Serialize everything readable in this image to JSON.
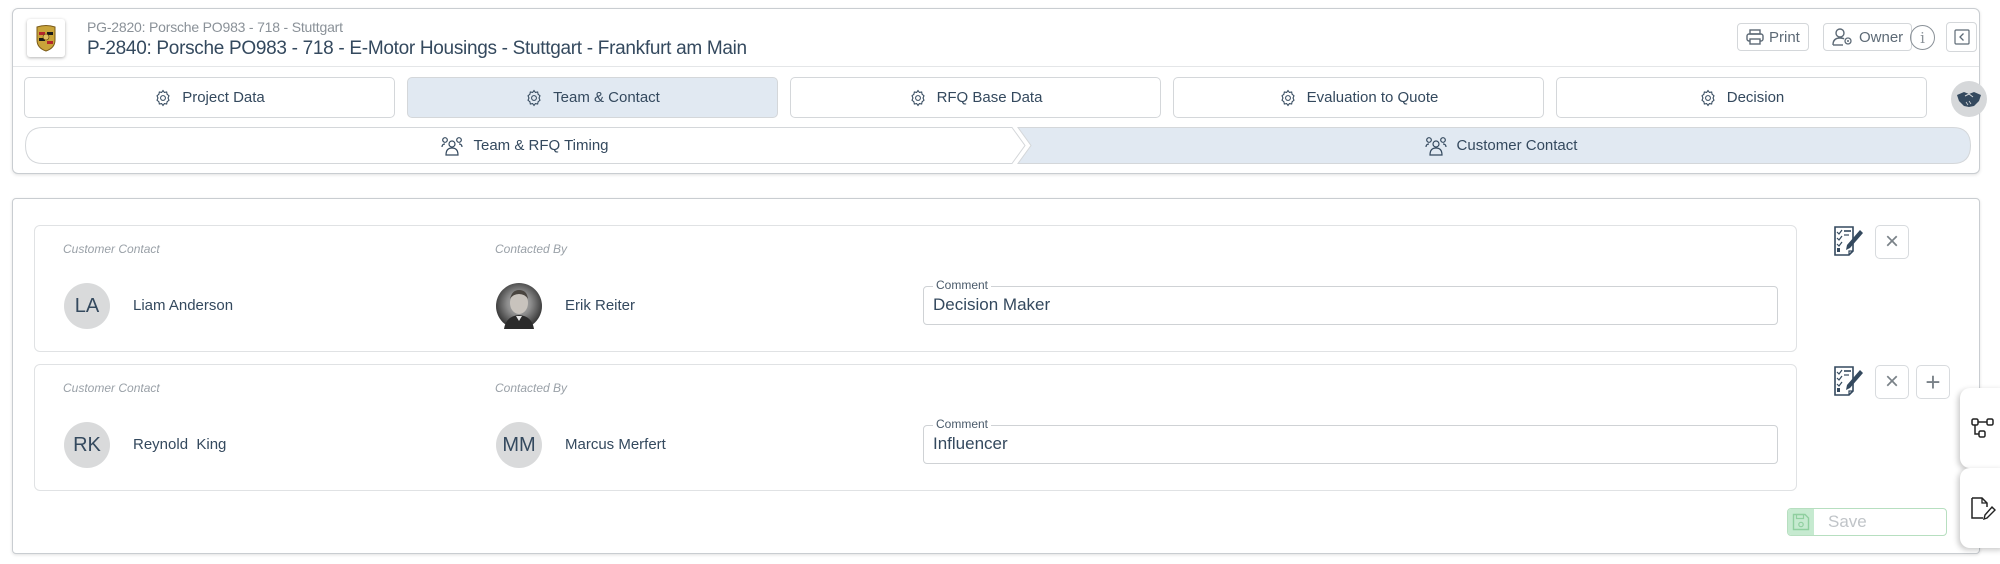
{
  "header": {
    "subtitle": "PG-2820: Porsche PO983 - 718 - Stuttgart",
    "title": "P-2840: Porsche PO983 - 718 - E-Motor Housings - Stuttgart - Frankfurt am Main",
    "print_label": "Print",
    "owner_label": "Owner",
    "info_glyph": "i"
  },
  "tabs": [
    {
      "label": "Project Data",
      "icon": "gear-icon",
      "active": false
    },
    {
      "label": "Team & Contact",
      "icon": "gear-icon",
      "active": true
    },
    {
      "label": "RFQ Base Data",
      "icon": "gear-icon",
      "active": false
    },
    {
      "label": "Evaluation to Quote",
      "icon": "gear-icon",
      "active": false
    },
    {
      "label": "Decision",
      "icon": "gear-icon",
      "active": false
    }
  ],
  "steps": [
    {
      "label": "Team & RFQ Timing",
      "icon": "users-icon",
      "active": false
    },
    {
      "label": "Customer Contact",
      "icon": "users-icon",
      "active": true
    }
  ],
  "contacts": [
    {
      "customer_contact_label": "Customer Contact",
      "contacted_by_label": "Contacted By",
      "customer_initials": "LA",
      "customer_name": "Liam Anderson",
      "contacted_by_initials": "",
      "contacted_by_name": "Erik Reiter",
      "contacted_by_has_photo": true,
      "comment_label": "Comment",
      "comment_value": "Decision Maker"
    },
    {
      "customer_contact_label": "Customer Contact",
      "contacted_by_label": "Contacted By",
      "customer_initials": "RK",
      "customer_name": "Reynold  King",
      "contacted_by_initials": "MM",
      "contacted_by_name": "Marcus Merfert",
      "contacted_by_has_photo": false,
      "comment_label": "Comment",
      "comment_value": "Influencer"
    }
  ],
  "actions": {
    "save_label": "Save",
    "close_glyph": "×",
    "add_glyph": "+"
  },
  "colors": {
    "active_tab_bg": "#e1e9f2",
    "text_primary": "#34495e",
    "save_green": "#c6ead0"
  }
}
